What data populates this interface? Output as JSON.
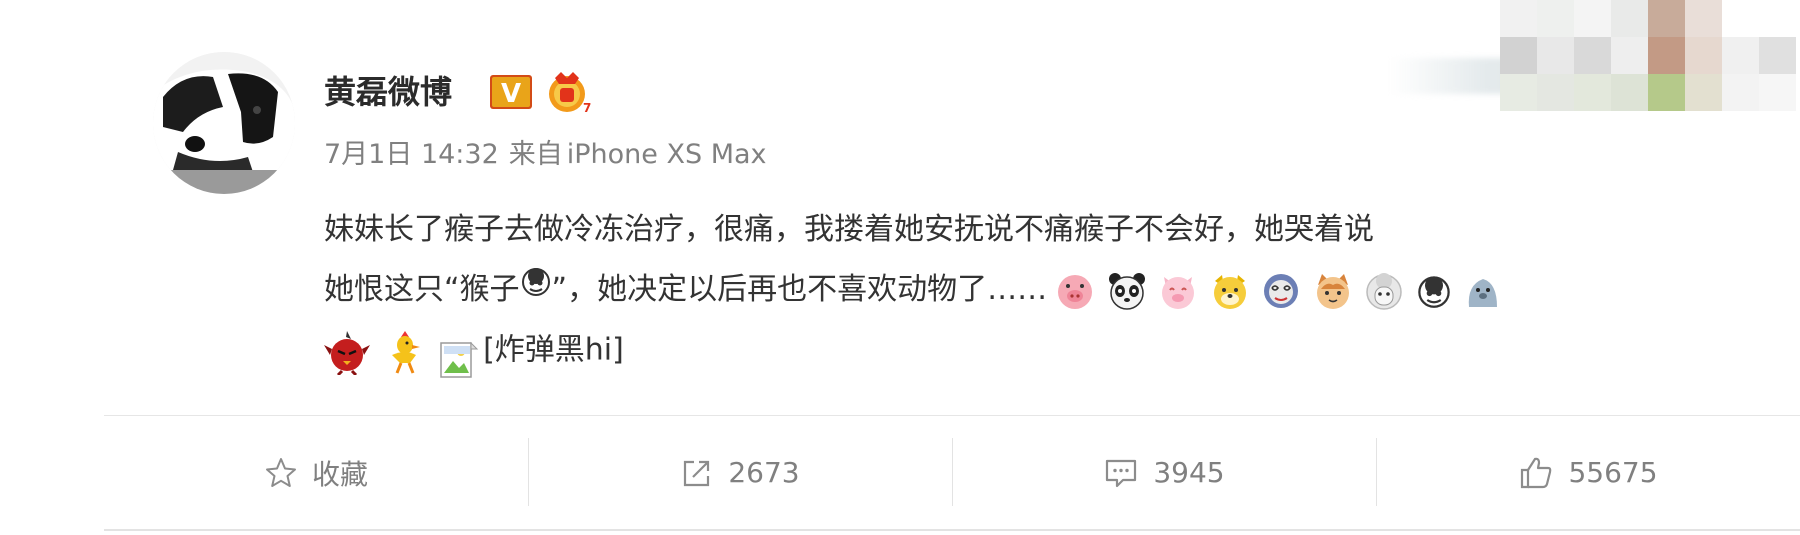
{
  "post": {
    "username": "黄磊微博",
    "verified_badge": "V",
    "date": "7月1日 14:32",
    "source_prefix": "来自",
    "device": "iPhone XS Max",
    "text_line1": "妹妹长了瘊子去做冷冻治疗，很痛，我搂着她安抚说不痛瘊子不会好，她哭着说",
    "text_line2_a": "她恨这只“猴子",
    "text_line2_b": "”，她决定以后再也不喜欢动物了……",
    "inline_tag": "[炸弹黑hi]"
  },
  "actions": {
    "favorite_label": "收藏",
    "repost_count": "2673",
    "comment_count": "3945",
    "like_count": "55675"
  },
  "icons": [
    "star-icon",
    "repost-icon",
    "comment-icon",
    "thumbs-up-icon",
    "monkey-emoji",
    "pig-emoji",
    "panda-emoji",
    "dog-emoji",
    "cat-emoji",
    "bomb-bird-emoji",
    "chicken-emoji",
    "broken-image-icon"
  ],
  "colors": {
    "text": "#333333",
    "meta": "#808080",
    "verified": "#e8a10f",
    "divider": "#e3e3e3"
  }
}
